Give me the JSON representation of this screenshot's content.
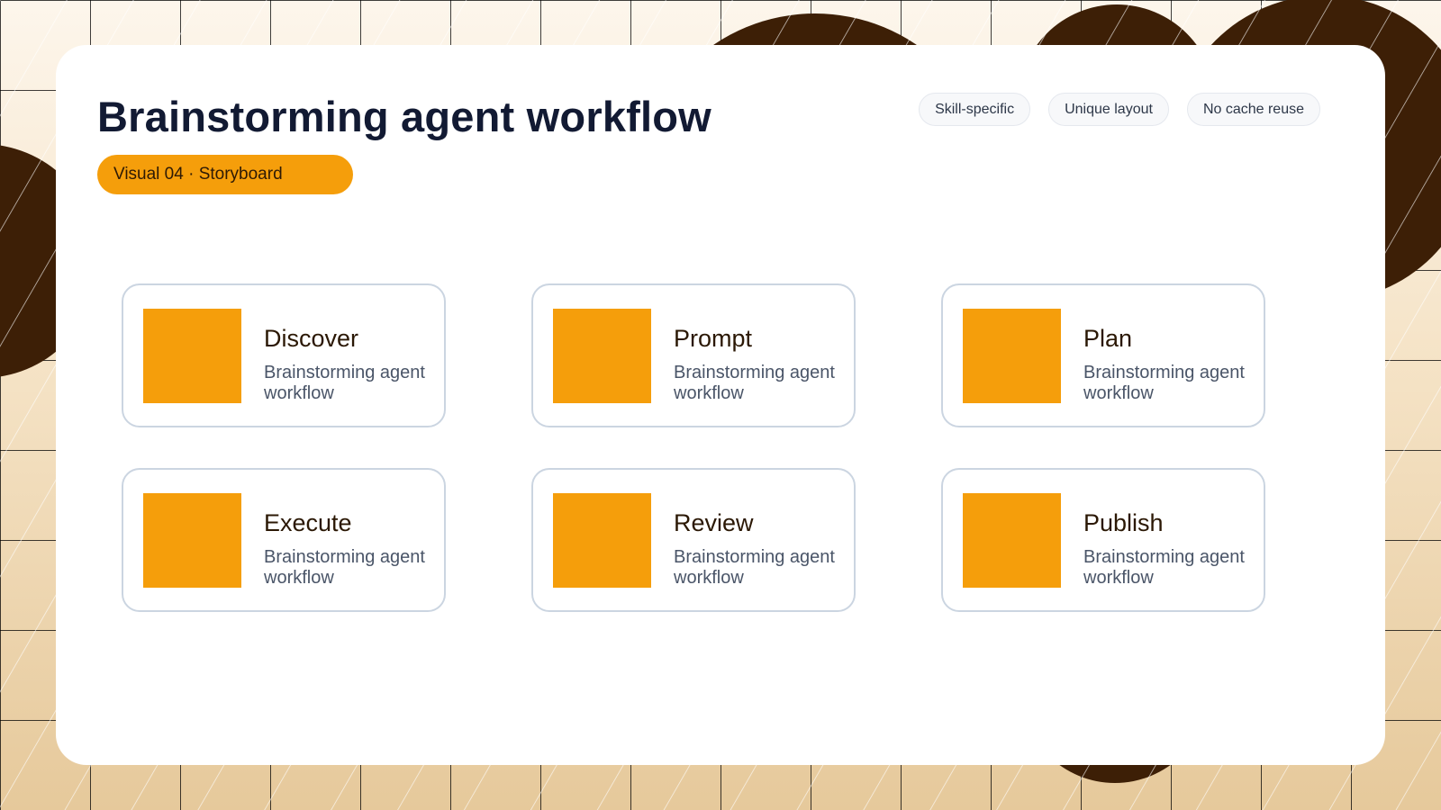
{
  "title": "Brainstorming agent workflow",
  "visual_label": "Visual 04 · Storyboard",
  "tags": [
    "Skill-specific",
    "Unique layout",
    "No cache reuse"
  ],
  "steps": [
    {
      "title": "Discover",
      "description": "Brainstorming agent workflow"
    },
    {
      "title": "Prompt",
      "description": "Brainstorming agent workflow"
    },
    {
      "title": "Plan",
      "description": "Brainstorming agent workflow"
    },
    {
      "title": "Execute",
      "description": "Brainstorming agent workflow"
    },
    {
      "title": "Review",
      "description": "Brainstorming agent workflow"
    },
    {
      "title": "Publish",
      "description": "Brainstorming agent workflow"
    }
  ],
  "colors": {
    "accent": "#f59e0b",
    "dark_decor": "#3d1f06",
    "title_text": "#121a33",
    "card_border": "#cbd5e1"
  }
}
